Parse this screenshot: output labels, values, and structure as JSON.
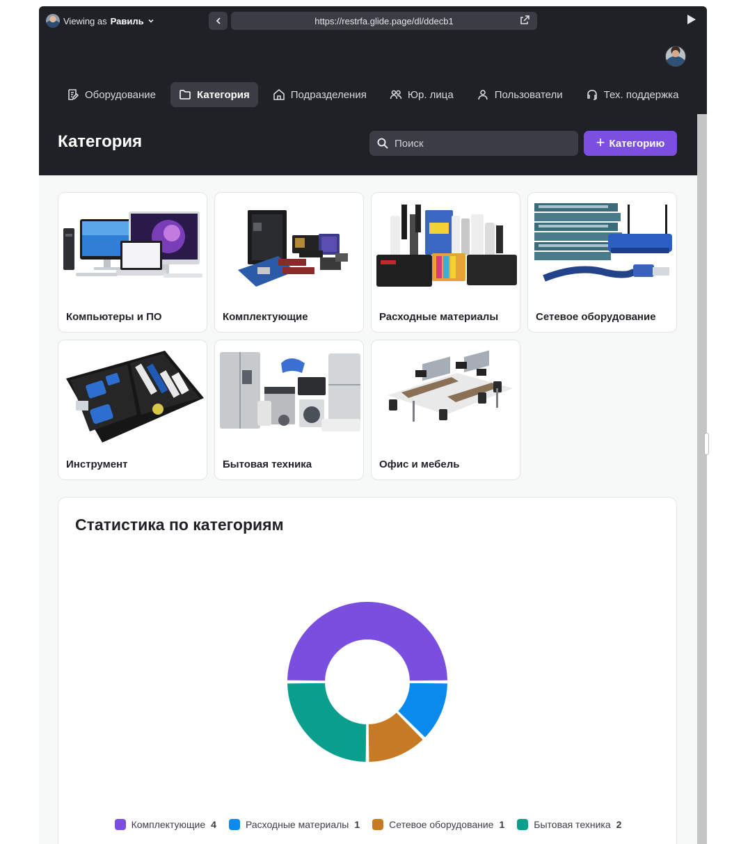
{
  "preview": {
    "viewing_prefix": "Viewing as",
    "viewing_user": "Равиль",
    "url": "https://restrfa.glide.page/dl/ddecb1"
  },
  "nav": {
    "items": [
      {
        "label": "Оборудование",
        "icon": "equipment-icon",
        "active": false
      },
      {
        "label": "Категория",
        "icon": "folder-icon",
        "active": true
      },
      {
        "label": "Подразделения",
        "icon": "home-icon",
        "active": false
      },
      {
        "label": "Юр. лица",
        "icon": "users-icon",
        "active": false
      },
      {
        "label": "Пользователи",
        "icon": "user-icon",
        "active": false
      },
      {
        "label": "Тех. поддержка",
        "icon": "headset-icon",
        "active": false
      }
    ]
  },
  "page": {
    "title": "Категория",
    "search_placeholder": "Поиск",
    "add_button": "Категорию"
  },
  "categories": [
    {
      "label": "Компьютеры и ПО",
      "image": "computers-image"
    },
    {
      "label": "Комплектующие",
      "image": "components-image"
    },
    {
      "label": "Расходные материалы",
      "image": "consumables-image"
    },
    {
      "label": "Сетевое оборудование",
      "image": "network-image"
    },
    {
      "label": "Инструмент",
      "image": "tools-image"
    },
    {
      "label": "Бытовая техника",
      "image": "appliances-image"
    },
    {
      "label": "Офис и мебель",
      "image": "office-image"
    }
  ],
  "stats": {
    "title": "Статистика по категориям"
  },
  "chart_data": {
    "type": "pie",
    "donut": true,
    "title": "Статистика по категориям",
    "series": [
      {
        "name": "Комплектующие",
        "value": 4,
        "color": "#7a4fdf"
      },
      {
        "name": "Расходные материалы",
        "value": 1,
        "color": "#0b8aed"
      },
      {
        "name": "Сетевое оборудование",
        "value": 1,
        "color": "#c67a24"
      },
      {
        "name": "Бытовая техника",
        "value": 2,
        "color": "#0a9e8c"
      }
    ],
    "legend_position": "bottom"
  }
}
